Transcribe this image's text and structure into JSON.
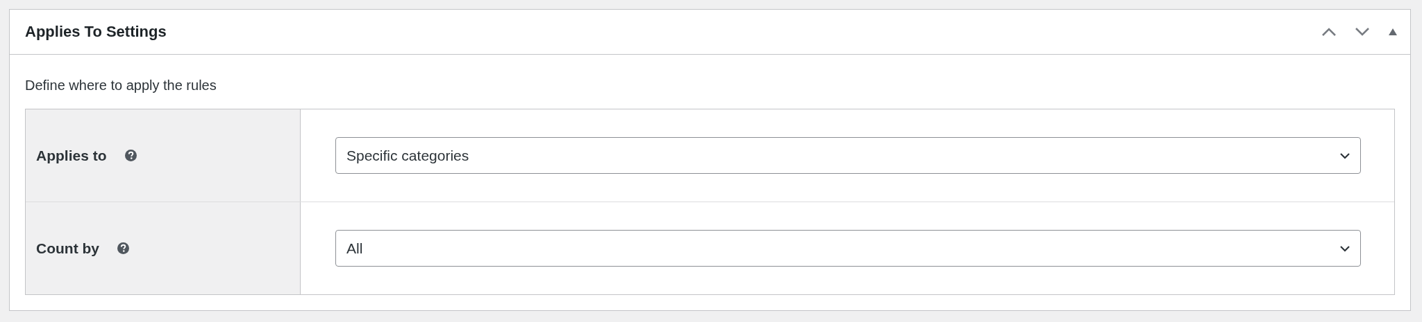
{
  "panel": {
    "title": "Applies To Settings",
    "expanded": true
  },
  "description": "Define where to apply the rules",
  "fields": [
    {
      "label": "Applies to",
      "value": "Specific categories"
    },
    {
      "label": "Count by",
      "value": "All"
    }
  ]
}
